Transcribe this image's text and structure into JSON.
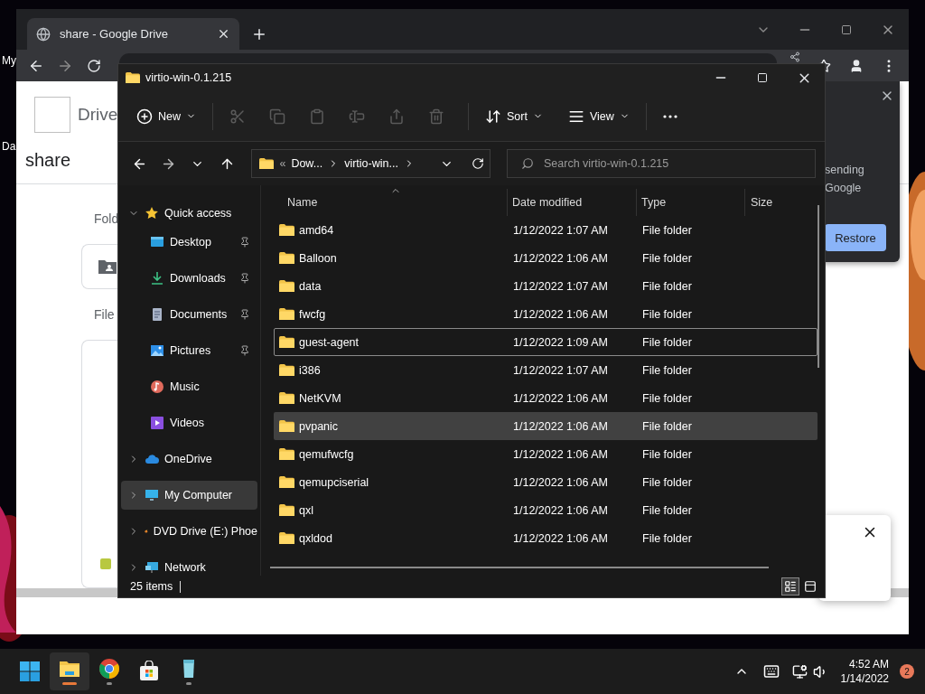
{
  "desktop_labels": [
    "My",
    "Da"
  ],
  "browser": {
    "tab": {
      "title": "share - Google Drive"
    },
    "page": {
      "logo_text": "Drive",
      "title": "share",
      "folders_label": "Fold",
      "files_label": "File",
      "popup": {
        "lines": [
          "sending",
          "Google"
        ],
        "button": "Restore"
      }
    }
  },
  "explorer": {
    "title": "virtio-win-0.1.215",
    "toolbar": [
      {
        "kind": "new",
        "label": "New",
        "disabled": false
      },
      {
        "kind": "cut",
        "disabled": true
      },
      {
        "kind": "copy",
        "disabled": true
      },
      {
        "kind": "paste",
        "disabled": true
      },
      {
        "kind": "rename",
        "disabled": true
      },
      {
        "kind": "share",
        "disabled": true
      },
      {
        "kind": "delete",
        "disabled": true
      },
      {
        "kind": "sort",
        "label": "Sort",
        "disabled": false
      },
      {
        "kind": "view",
        "label": "View",
        "disabled": false
      },
      {
        "kind": "more",
        "disabled": false
      }
    ],
    "breadcrumb": {
      "overflow": "«",
      "parts": [
        "Dow...",
        "virtio-win..."
      ]
    },
    "search": {
      "placeholder": "Search virtio-win-0.1.215"
    },
    "nav": [
      {
        "label": "Quick access",
        "kind": "star",
        "expanded": true,
        "selected": false,
        "children": [
          {
            "label": "Desktop",
            "kind": "desktop",
            "pinned": true,
            "selected": false
          },
          {
            "label": "Downloads",
            "kind": "downloads",
            "pinned": true,
            "selected": false
          },
          {
            "label": "Documents",
            "kind": "documents",
            "pinned": true,
            "selected": false
          },
          {
            "label": "Pictures",
            "kind": "pictures",
            "pinned": true,
            "selected": false
          },
          {
            "label": "Music",
            "kind": "music",
            "pinned": false,
            "selected": false
          },
          {
            "label": "Videos",
            "kind": "videos",
            "pinned": false,
            "selected": false
          }
        ]
      },
      {
        "label": "OneDrive",
        "kind": "cloud",
        "expanded": false,
        "selected": false
      },
      {
        "label": "My Computer",
        "kind": "computer",
        "expanded": false,
        "selected": true
      },
      {
        "label": "DVD Drive (E:) Phoe",
        "kind": "dvd",
        "expanded": false,
        "selected": false
      },
      {
        "label": "Network",
        "kind": "network",
        "expanded": false,
        "selected": false
      }
    ],
    "columns": [
      {
        "label": "Name",
        "sorted": true
      },
      {
        "label": "Date modified",
        "sorted": false
      },
      {
        "label": "Type",
        "sorted": false
      },
      {
        "label": "Size",
        "sorted": false
      }
    ],
    "rows": [
      {
        "name": "amd64",
        "date": "1/12/2022 1:07 AM",
        "type": "File folder",
        "selected": false,
        "focused": false
      },
      {
        "name": "Balloon",
        "date": "1/12/2022 1:06 AM",
        "type": "File folder",
        "selected": false,
        "focused": false
      },
      {
        "name": "data",
        "date": "1/12/2022 1:07 AM",
        "type": "File folder",
        "selected": false,
        "focused": false
      },
      {
        "name": "fwcfg",
        "date": "1/12/2022 1:06 AM",
        "type": "File folder",
        "selected": false,
        "focused": false
      },
      {
        "name": "guest-agent",
        "date": "1/12/2022 1:09 AM",
        "type": "File folder",
        "selected": false,
        "focused": true
      },
      {
        "name": "i386",
        "date": "1/12/2022 1:07 AM",
        "type": "File folder",
        "selected": false,
        "focused": false
      },
      {
        "name": "NetKVM",
        "date": "1/12/2022 1:06 AM",
        "type": "File folder",
        "selected": false,
        "focused": false
      },
      {
        "name": "pvpanic",
        "date": "1/12/2022 1:06 AM",
        "type": "File folder",
        "selected": true,
        "focused": false
      },
      {
        "name": "qemufwcfg",
        "date": "1/12/2022 1:06 AM",
        "type": "File folder",
        "selected": false,
        "focused": false
      },
      {
        "name": "qemupciserial",
        "date": "1/12/2022 1:06 AM",
        "type": "File folder",
        "selected": false,
        "focused": false
      },
      {
        "name": "qxl",
        "date": "1/12/2022 1:06 AM",
        "type": "File folder",
        "selected": false,
        "focused": false
      },
      {
        "name": "qxldod",
        "date": "1/12/2022 1:06 AM",
        "type": "File folder",
        "selected": false,
        "focused": false
      }
    ],
    "status": "25 items",
    "views": [
      {
        "kind": "details",
        "selected": true
      },
      {
        "kind": "tiles",
        "selected": false
      }
    ]
  },
  "taskbar": {
    "apps": [
      {
        "kind": "start",
        "running": false,
        "active": false
      },
      {
        "kind": "explorer",
        "running": true,
        "active": true
      },
      {
        "kind": "chrome",
        "running": true,
        "active": false
      },
      {
        "kind": "store",
        "running": false,
        "active": false
      },
      {
        "kind": "notepad",
        "running": true,
        "active": false
      }
    ],
    "time": "4:52 AM",
    "date": "1/14/2022",
    "notifications": "2"
  }
}
